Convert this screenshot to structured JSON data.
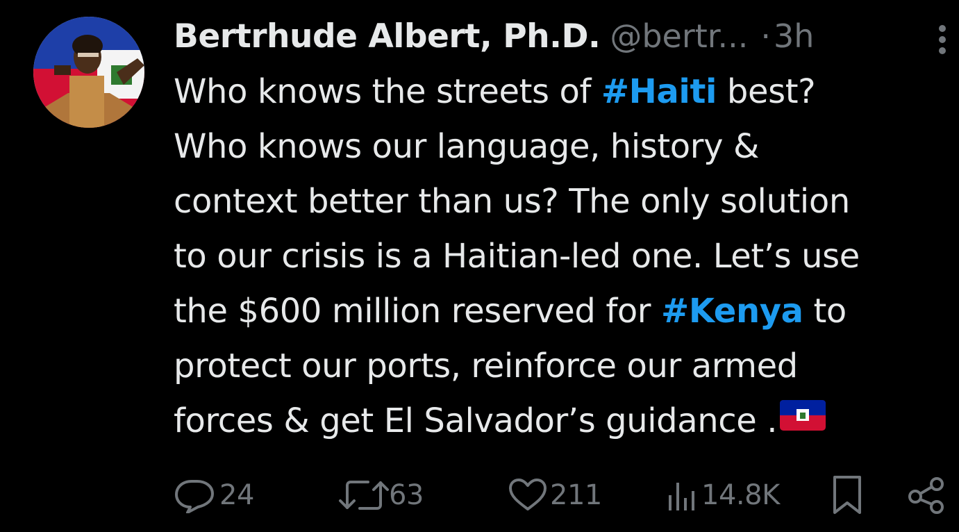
{
  "author": {
    "name": "Bertrhude Albert, Ph.D.",
    "handle": "@bertr...",
    "separator": "·",
    "time": "3h"
  },
  "tweet": {
    "line1_a": "Who knows the streets of ",
    "hashtag1": "#Haiti",
    "line1_b": " best?",
    "line2": "Who knows our language, history &",
    "line3": "context better than us? The only solution",
    "line4": "to our crisis is a Haitian-led one. Let’s use",
    "line5_a": "the $600 million reserved for ",
    "hashtag2": "#Kenya",
    "line5_b": " to",
    "line6": "protect our ports, reinforce our armed",
    "line7": "forces & get El Salvador’s guidance ."
  },
  "metrics": {
    "replies": "24",
    "reposts": "63",
    "likes": "211",
    "views": "14.8K"
  },
  "icons": {
    "reply": "reply-icon",
    "repost": "repost-icon",
    "like": "heart-icon",
    "views": "views-icon",
    "bookmark": "bookmark-icon",
    "share": "share-icon",
    "more": "more-options-icon",
    "flag": "haiti-flag-emoji"
  },
  "colors": {
    "background": "#000000",
    "text": "#e7e9ea",
    "muted": "#71767b",
    "hashtag": "#1d9bf0"
  }
}
